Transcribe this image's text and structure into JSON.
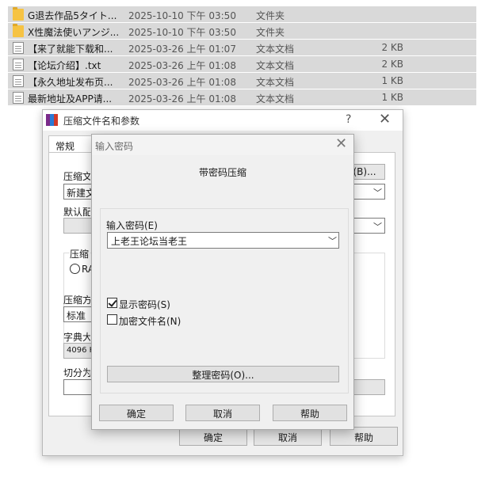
{
  "files": [
    {
      "icon": "folder",
      "name": "G退去作品5タイト...",
      "date": "2025-10-10 下午 03:50",
      "type": "文件夹",
      "size": ""
    },
    {
      "icon": "folder",
      "name": "X性魔法使いアンジ...",
      "date": "2025-10-10 下午 03:50",
      "type": "文件夹",
      "size": ""
    },
    {
      "icon": "doc",
      "name": "【来了就能下载和...",
      "date": "2025-03-26 上午 01:07",
      "type": "文本文档",
      "size": "2 KB"
    },
    {
      "icon": "doc",
      "name": "【论坛介绍】.txt",
      "date": "2025-03-26 上午 01:08",
      "type": "文本文档",
      "size": "2 KB"
    },
    {
      "icon": "doc",
      "name": "【永久地址发布页...",
      "date": "2025-03-26 上午 01:08",
      "type": "文本文档",
      "size": "1 KB"
    },
    {
      "icon": "doc",
      "name": "最新地址及APP请...",
      "date": "2025-03-26 上午 01:08",
      "type": "文本文档",
      "size": "1 KB"
    }
  ],
  "back_window": {
    "title": "压缩文件名和参数",
    "help": "?",
    "close": "✕",
    "tab_general": "常规",
    "label_archive_name": "压缩文",
    "archive_name_value": "新建文",
    "browse_button": "(B)...",
    "label_default_profile": "默认配",
    "label_format": "压缩",
    "format_option": "RA",
    "label_method": "压缩方",
    "method_value": "标准",
    "label_dictionary": "字典大",
    "dictionary_value": "4096 K",
    "label_split": "切分为",
    "ok": "确定",
    "cancel": "取消",
    "help_button": "帮助"
  },
  "password_dialog": {
    "title": "输入密码",
    "close": "✕",
    "heading": "带密码压缩",
    "password_label": "输入密码(E)",
    "password_value": "上老王论坛当老王",
    "show_password_label": "显示密码(S)",
    "show_password_checked": true,
    "encrypt_names_label": "加密文件名(N)",
    "encrypt_names_checked": false,
    "organize_button": "整理密码(O)...",
    "ok": "确定",
    "cancel": "取消",
    "help": "帮助"
  },
  "icons": {
    "folder": "folder-icon",
    "doc": "text-file-icon",
    "app": "winrar-icon",
    "chevron": "chevron-down-icon"
  },
  "colors": {
    "selection_bg": "#d9d9d9",
    "window_bg": "#f0f0f0",
    "folder": "#f6c343",
    "app_icon": [
      "#7b2a8a",
      "#2a7ad6",
      "#d13a2a"
    ]
  }
}
